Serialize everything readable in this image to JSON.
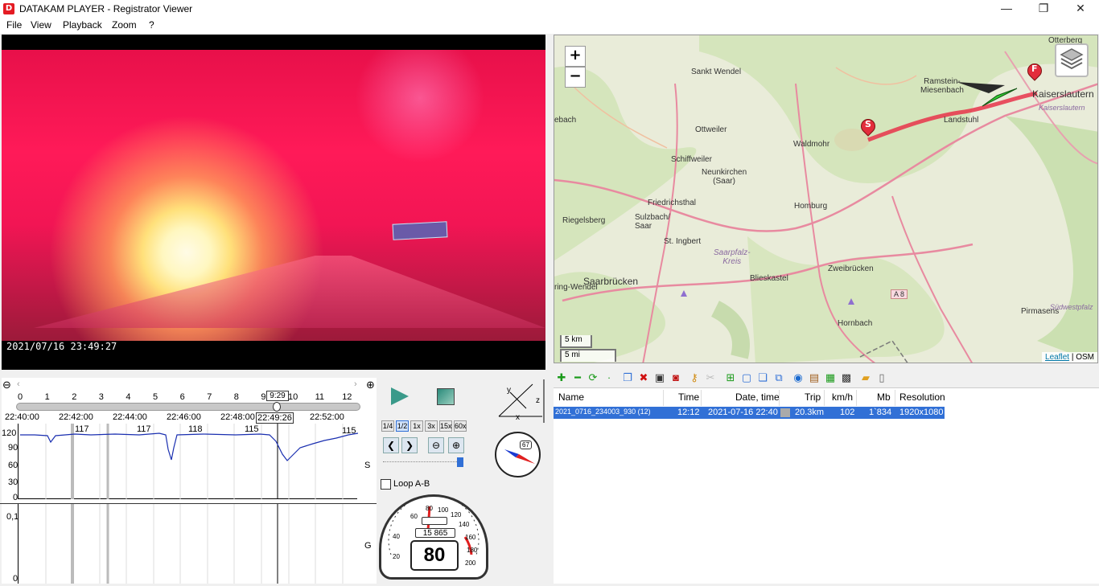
{
  "window": {
    "title": "DATAKAM PLAYER - Registrator Viewer",
    "icon_letter": "D",
    "min_glyph": "—",
    "max_glyph": "❐",
    "close_glyph": "✕"
  },
  "menu": [
    "File",
    "View",
    "Playback",
    "Zoom",
    "?"
  ],
  "video": {
    "timestamp": "2021/07/16  23:49:27"
  },
  "map": {
    "zoom_in": "+",
    "zoom_out": "−",
    "labels": [
      "Otterberg",
      "Sankt Wendel",
      "Ramstein-\nMiesenbach",
      "Kaiserslautern",
      "Landstuhl",
      "Ottweiler",
      "Waldmohr",
      "Schiffweiler",
      "Neunkirchen\n(Saar)",
      "Friedrichsthal",
      "Riegelsberg",
      "Sulzbach/\nSaar",
      "Homburg",
      "St. Ingbert",
      "Saarpfalz-\nKreis",
      "Blieskastel",
      "Zweibrücken",
      "Saarbrücken",
      "Pirmasens",
      "Hornbach",
      "A 8",
      "Kaiserslautern",
      "Südwestpfalz",
      "ebach",
      "ring-Wendel"
    ],
    "marker_start": "S",
    "marker_finish": "F",
    "scale_km": "5 km",
    "scale_mi": "5 mi",
    "attribution_leaflet": "Leaflet",
    "attribution_sep": " | ",
    "attribution_osm": "OSM"
  },
  "timeline": {
    "ticks": [
      "0",
      "1",
      "2",
      "3",
      "4",
      "5",
      "6",
      "7",
      "8",
      "9",
      "10",
      "11",
      "12"
    ],
    "tooltip": "9:29",
    "times": [
      "22:40:00",
      "22:42:00",
      "22:44:00",
      "22:46:00",
      "22:48:00",
      "22:49:26",
      "22:52:00"
    ],
    "speed_peaks": [
      "117",
      "117",
      "118",
      "115",
      "115"
    ],
    "speed_axis": [
      "120",
      "90",
      "60",
      "30",
      "0"
    ],
    "g_axis": [
      "0,1",
      "0"
    ],
    "speed_label": "S",
    "g_label": "G",
    "zoom_out": "⊖",
    "zoom_in": "⊕"
  },
  "controls": {
    "speeds": [
      "1/4",
      "1/2",
      "1x",
      "3x",
      "15x",
      "60x"
    ],
    "loop_label": "Loop A-B",
    "speedometer_value": "80",
    "odometer": "15 865",
    "dial_numbers": [
      "20",
      "40",
      "60",
      "80",
      "100",
      "120",
      "140",
      "160",
      "180",
      "200"
    ],
    "compass_value": "67",
    "axis_x": "x",
    "axis_y": "y",
    "axis_z": "z"
  },
  "filelist": {
    "headers": [
      "Name",
      "Time",
      "Date, time",
      "Trip",
      "km/h",
      "Mb",
      "Resolution"
    ],
    "rows": [
      {
        "name": "2021_0716_234003_930 (12)",
        "time": "12:12",
        "date": "2021-07-16 22:40",
        "trip": "20.3km",
        "kmh": "102",
        "mb": "1`834",
        "res": "1920x1080"
      }
    ]
  },
  "colors": {
    "accent": "#3170d6",
    "route": "#e8344a",
    "speed_line": "#1a2fb0"
  }
}
